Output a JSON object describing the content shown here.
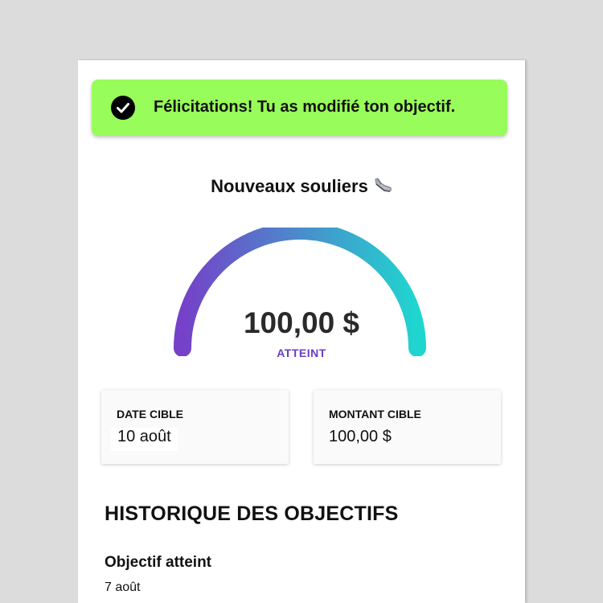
{
  "toast": {
    "message": "Félicitations! Tu as modifié ton objectif.",
    "icon": "check-circle-icon",
    "color": "#98fc5a"
  },
  "goal": {
    "title": "Nouveaux souliers",
    "emoji_icon": "sneaker-icon",
    "amount": "100,00 $",
    "status": "ATTEINT",
    "progress": 1.0,
    "gradient_start": "#7541c8",
    "gradient_end": "#1fd6cf"
  },
  "cards": {
    "target_date_label": "DATE CIBLE",
    "target_date_value": "10 août",
    "target_amount_label": "MONTANT CIBLE",
    "target_amount_value": "100,00 $"
  },
  "history": {
    "title": "HISTORIQUE DES OBJECTIFS",
    "items": [
      {
        "title": "Objectif atteint",
        "date": "7 août"
      }
    ]
  }
}
